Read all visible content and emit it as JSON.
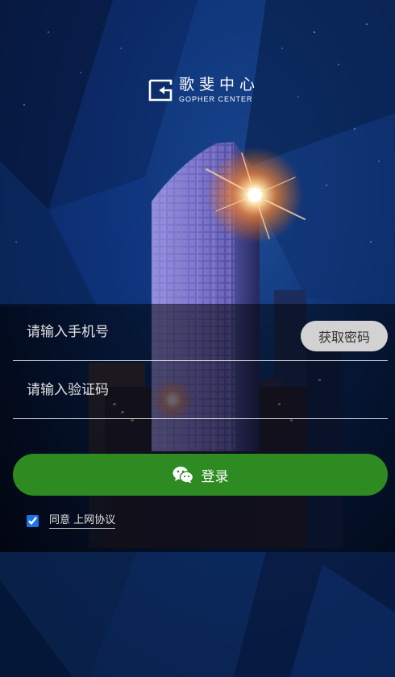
{
  "logo": {
    "name_cn": "歌斐中心",
    "name_en": "GOPHER CENTER"
  },
  "form": {
    "phone_placeholder": "请输入手机号",
    "phone_value": "",
    "code_placeholder": "请输入验证码",
    "code_value": "",
    "get_code_label": "获取密码",
    "login_label": "登录",
    "agree_checked": true,
    "agree_prefix": "同意",
    "agree_link": "上网协议"
  },
  "icons": {
    "logo": "gopher-logo-icon",
    "login": "wechat-icon"
  },
  "colors": {
    "login_button": "#2e8b22",
    "get_code_button": "#d2d2d2",
    "background": "#06132e"
  }
}
